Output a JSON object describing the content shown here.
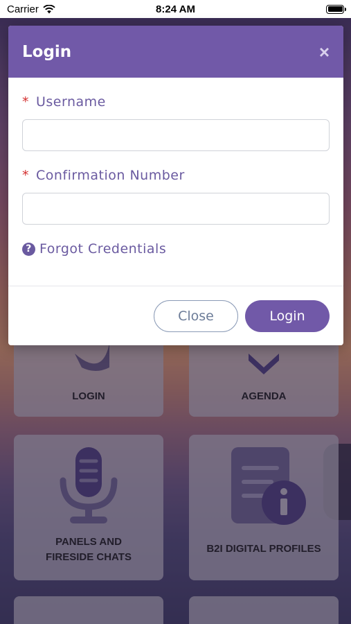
{
  "status_bar": {
    "carrier": "Carrier",
    "time": "8:24 AM",
    "battery_level": 1.0
  },
  "tiles": [
    {
      "label": "LOGIN",
      "icon": "login-icon"
    },
    {
      "label": "AGENDA",
      "icon": "agenda-icon"
    },
    {
      "label_line1": "PANELS AND",
      "label_line2": "FIRESIDE CHATS",
      "icon": "microphone-icon"
    },
    {
      "label": "B2I DIGITAL PROFILES",
      "icon": "document-info-icon"
    }
  ],
  "modal": {
    "title": "Login",
    "close_symbol": "×",
    "username": {
      "required_mark": "*",
      "label": "Username",
      "value": "",
      "placeholder": ""
    },
    "confirmation": {
      "required_mark": "*",
      "label": "Confirmation Number",
      "value": "",
      "placeholder": ""
    },
    "forgot_label": "Forgot Credentials",
    "forgot_icon_glyph": "?",
    "close_button": "Close",
    "login_button": "Login"
  },
  "colors": {
    "accent": "#7159a8",
    "label_text": "#6a5aa0",
    "required": "#d43030"
  }
}
